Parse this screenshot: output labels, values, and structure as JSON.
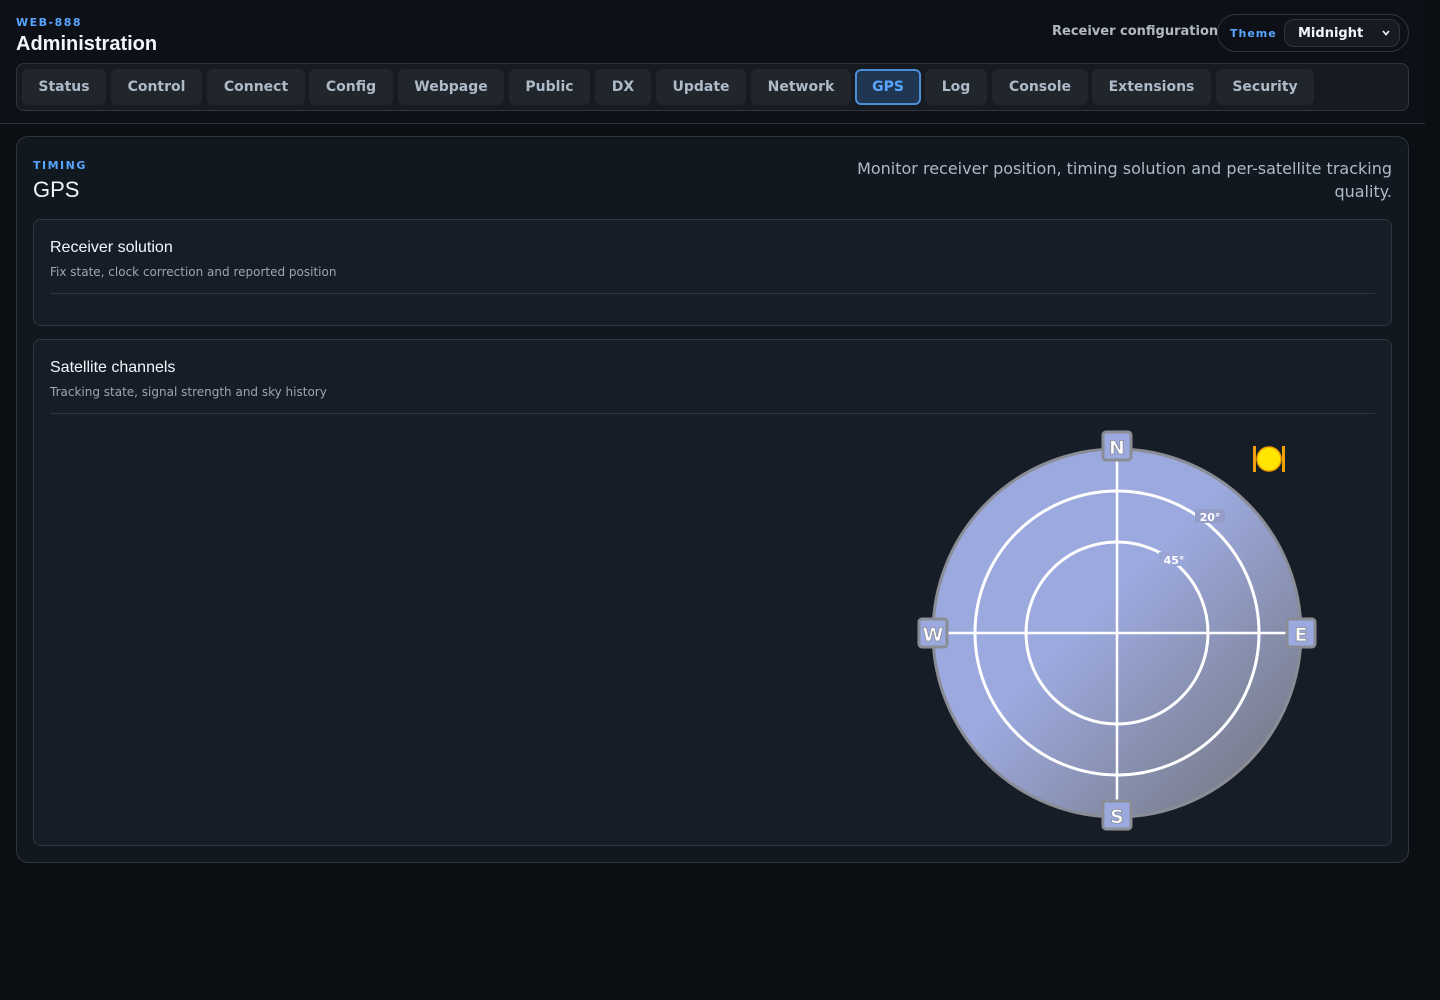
{
  "header": {
    "device_id": "WEB-888",
    "title": "Administration",
    "receiver_config_label": "Receiver configuration",
    "theme": {
      "label": "Theme",
      "selected": "Midnight"
    }
  },
  "tabs": [
    {
      "label": "Status",
      "active": false
    },
    {
      "label": "Control",
      "active": false
    },
    {
      "label": "Connect",
      "active": false
    },
    {
      "label": "Config",
      "active": false
    },
    {
      "label": "Webpage",
      "active": false
    },
    {
      "label": "Public",
      "active": false
    },
    {
      "label": "DX",
      "active": false
    },
    {
      "label": "Update",
      "active": false
    },
    {
      "label": "Network",
      "active": false
    },
    {
      "label": "GPS",
      "active": true
    },
    {
      "label": "Log",
      "active": false
    },
    {
      "label": "Console",
      "active": false
    },
    {
      "label": "Extensions",
      "active": false
    },
    {
      "label": "Security",
      "active": false
    }
  ],
  "section": {
    "kicker": "TIMING",
    "title": "GPS",
    "description": "Monitor receiver position, timing solution and per-satellite tracking quality."
  },
  "cards": {
    "receiver": {
      "title": "Receiver solution",
      "subtitle": "Fix state, clock correction and reported position"
    },
    "satellites": {
      "title": "Satellite channels",
      "subtitle": "Tracking state, signal strength and sky history"
    }
  },
  "skyplot": {
    "compass": {
      "north": "N",
      "south": "S",
      "east": "E",
      "west": "W"
    },
    "ring_labels": [
      "20°",
      "45°"
    ],
    "colors": {
      "sky_light": "#9ca9de",
      "sky_dark": "#6f7175",
      "sun": "#ffe500"
    },
    "sun_icon": "sun-icon"
  },
  "colors": {
    "background": "#0b0f14",
    "accent": "#58a6ff",
    "tab_active_border": "#4c8dd6"
  }
}
